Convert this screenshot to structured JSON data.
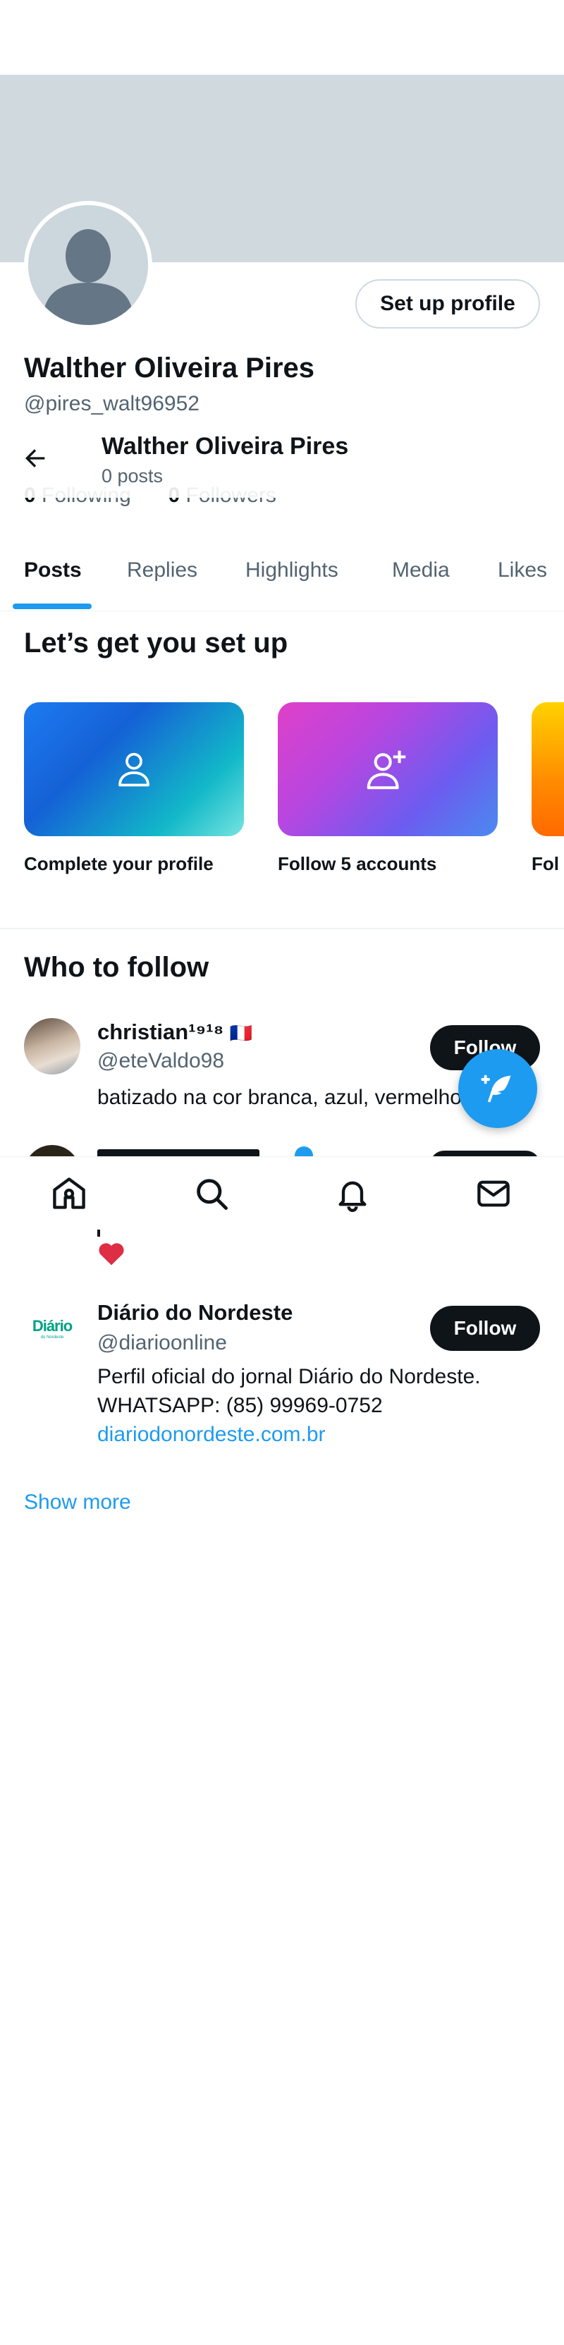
{
  "profile": {
    "setup_button": "Set up profile",
    "name": "Walther Oliveira Pires",
    "handle": "@pires_walt96952",
    "following_count": "0",
    "following_label": "Following",
    "followers_count": "0",
    "followers_label": "Followers",
    "colors": {
      "banner": "#cfd9de",
      "avatar_bg": "#ccd6dd",
      "avatar_figure": "#657786"
    }
  },
  "sticky_header": {
    "name": "Walther Oliveira Pires",
    "posts": "0 posts"
  },
  "tabs": [
    {
      "label": "Posts",
      "active": true
    },
    {
      "label": "Replies"
    },
    {
      "label": "Highlights"
    },
    {
      "label": "Media"
    },
    {
      "label": "Likes"
    }
  ],
  "setup": {
    "title": "Let’s get you set up",
    "cards": [
      {
        "label": "Complete your profile",
        "icon": "person-icon"
      },
      {
        "label": "Follow 5 accounts",
        "icon": "person-add-icon"
      },
      {
        "label": "Fol"
      }
    ]
  },
  "who_to_follow": {
    "title": "Who to follow",
    "users": [
      {
        "name": "christian¹⁹¹⁸",
        "flag": "🇫🇷",
        "handle": "@eteValdo98",
        "bio": "batizado na cor branca, azul, vermelho",
        "button": "Follow"
      },
      {
        "name": "Diário do Nordeste",
        "handle": "@diarioonline",
        "bio_line1": "Perfil oficial do jornal Diário do Nordeste.",
        "bio_line2": "WHATSAPP: (85) 99969-0752",
        "link": "diariodonordeste.com.br",
        "avatar_text": "Diário",
        "avatar_sub": "do Nordeste",
        "button": "Follow"
      }
    ],
    "show_more": "Show more"
  },
  "bottom_nav": {
    "items": [
      "home-icon",
      "search-icon",
      "notifications-icon",
      "messages-icon"
    ]
  },
  "accent": "#1d9bf0"
}
